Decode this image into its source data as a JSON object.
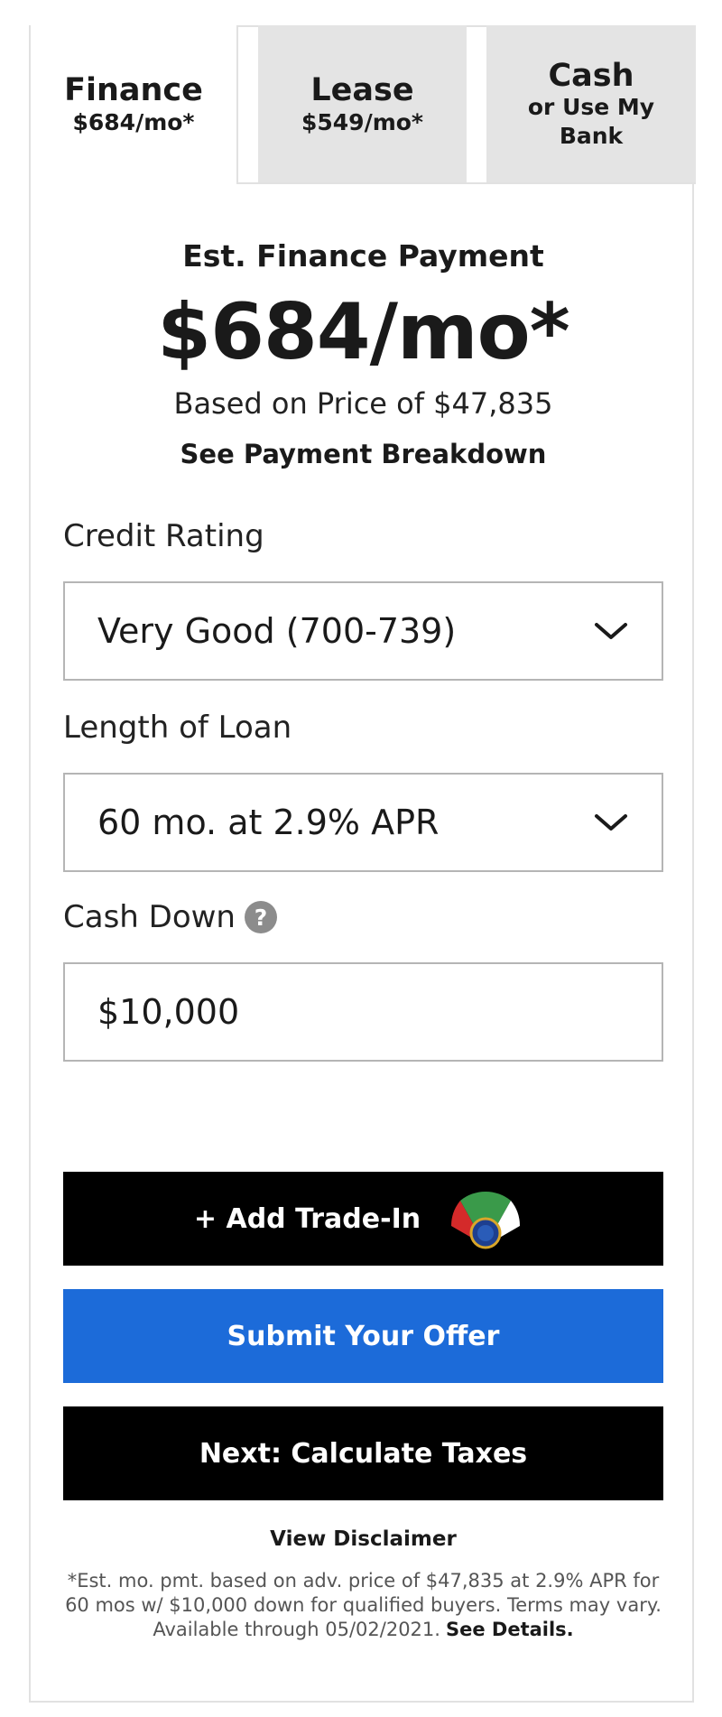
{
  "tabs": [
    {
      "title": "Finance",
      "subtitle": "$684/mo*"
    },
    {
      "title": "Lease",
      "subtitle": "$549/mo*"
    },
    {
      "title": "Cash",
      "subtitle": "or Use My Bank"
    }
  ],
  "summary": {
    "label": "Est. Finance Payment",
    "amount": "$684/mo*",
    "based_on": "Based on Price of $47,835",
    "breakdown_link": "See Payment Breakdown"
  },
  "credit_rating": {
    "label": "Credit Rating",
    "value": "Very Good (700-739)"
  },
  "loan_length": {
    "label": "Length of Loan",
    "value": "60 mo. at 2.9% APR"
  },
  "cash_down": {
    "label": "Cash Down",
    "help_icon": "?",
    "value": "$10,000"
  },
  "buttons": {
    "trade_in": "+ Add Trade-In",
    "submit": "Submit Your Offer",
    "taxes": "Next: Calculate Taxes"
  },
  "disclaimer": {
    "link": "View Disclaimer",
    "text": "*Est. mo. pmt. based on adv. price of $47,835 at 2.9% APR for 60 mos w/ $10,000 down for qualified buyers. Terms may vary. Available through 05/02/2021.",
    "details_link": "See Details."
  },
  "icons": {
    "chevron": "chevron-down-icon",
    "help": "question-circle-icon",
    "kbb": "kelley-blue-book-logo"
  },
  "colors": {
    "submit_blue": "#1c6bd9",
    "black_button": "#000000",
    "inactive_tab": "#e4e4e4"
  }
}
